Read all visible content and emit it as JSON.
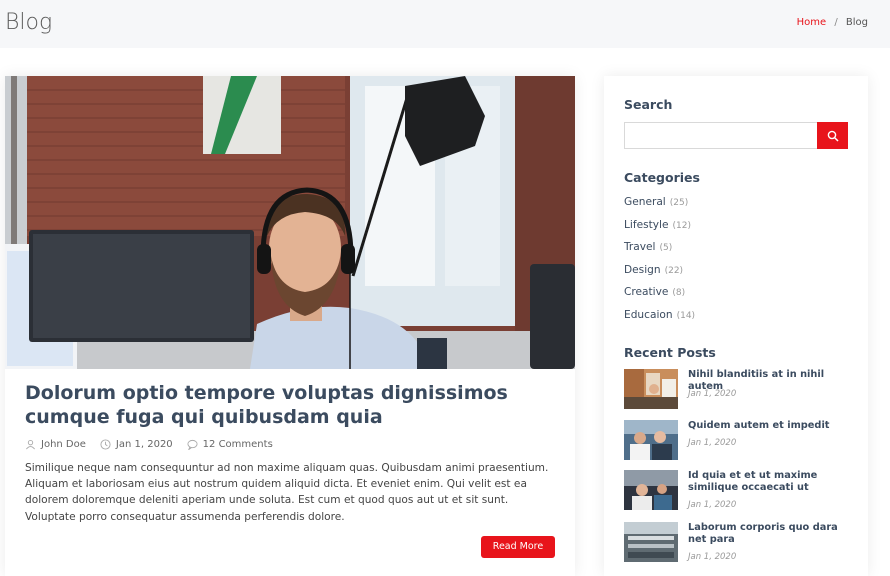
{
  "header": {
    "title": "Blog",
    "breadcrumb": {
      "home": "Home",
      "separator": "/",
      "current": "Blog"
    }
  },
  "article": {
    "title": "Dolorum optio tempore voluptas dignissimos cumque fuga qui quibusdam quia",
    "author": "John Doe",
    "date": "Jan 1, 2020",
    "comments": "12 Comments",
    "excerpt": "Similique neque nam consequuntur ad non maxime aliquam quas. Quibusdam animi praesentium. Aliquam et laboriosam eius aut nostrum quidem aliquid dicta. Et eveniet enim. Qui velit est ea dolorem doloremque deleniti aperiam unde soluta. Est cum et quod quos aut ut et sit sunt. Voluptate porro consequatur assumenda perferendis dolore.",
    "read_more": "Read More",
    "accent_color": "#e8141b"
  },
  "sidebar": {
    "search": {
      "heading": "Search",
      "placeholder": ""
    },
    "categories": {
      "heading": "Categories",
      "items": [
        {
          "name": "General",
          "count": "(25)"
        },
        {
          "name": "Lifestyle",
          "count": "(12)"
        },
        {
          "name": "Travel",
          "count": "(5)"
        },
        {
          "name": "Design",
          "count": "(22)"
        },
        {
          "name": "Creative",
          "count": "(8)"
        },
        {
          "name": "Educaion",
          "count": "(14)"
        }
      ]
    },
    "recent_posts": {
      "heading": "Recent Posts",
      "items": [
        {
          "title": "Nihil blanditiis at in nihil autem",
          "date": "Jan 1, 2020"
        },
        {
          "title": "Quidem autem et impedit",
          "date": "Jan 1, 2020"
        },
        {
          "title": "Id quia et et ut maxime similique occaecati ut",
          "date": "Jan 1, 2020"
        },
        {
          "title": "Laborum corporis quo dara net para",
          "date": "Jan 1, 2020"
        }
      ]
    }
  }
}
